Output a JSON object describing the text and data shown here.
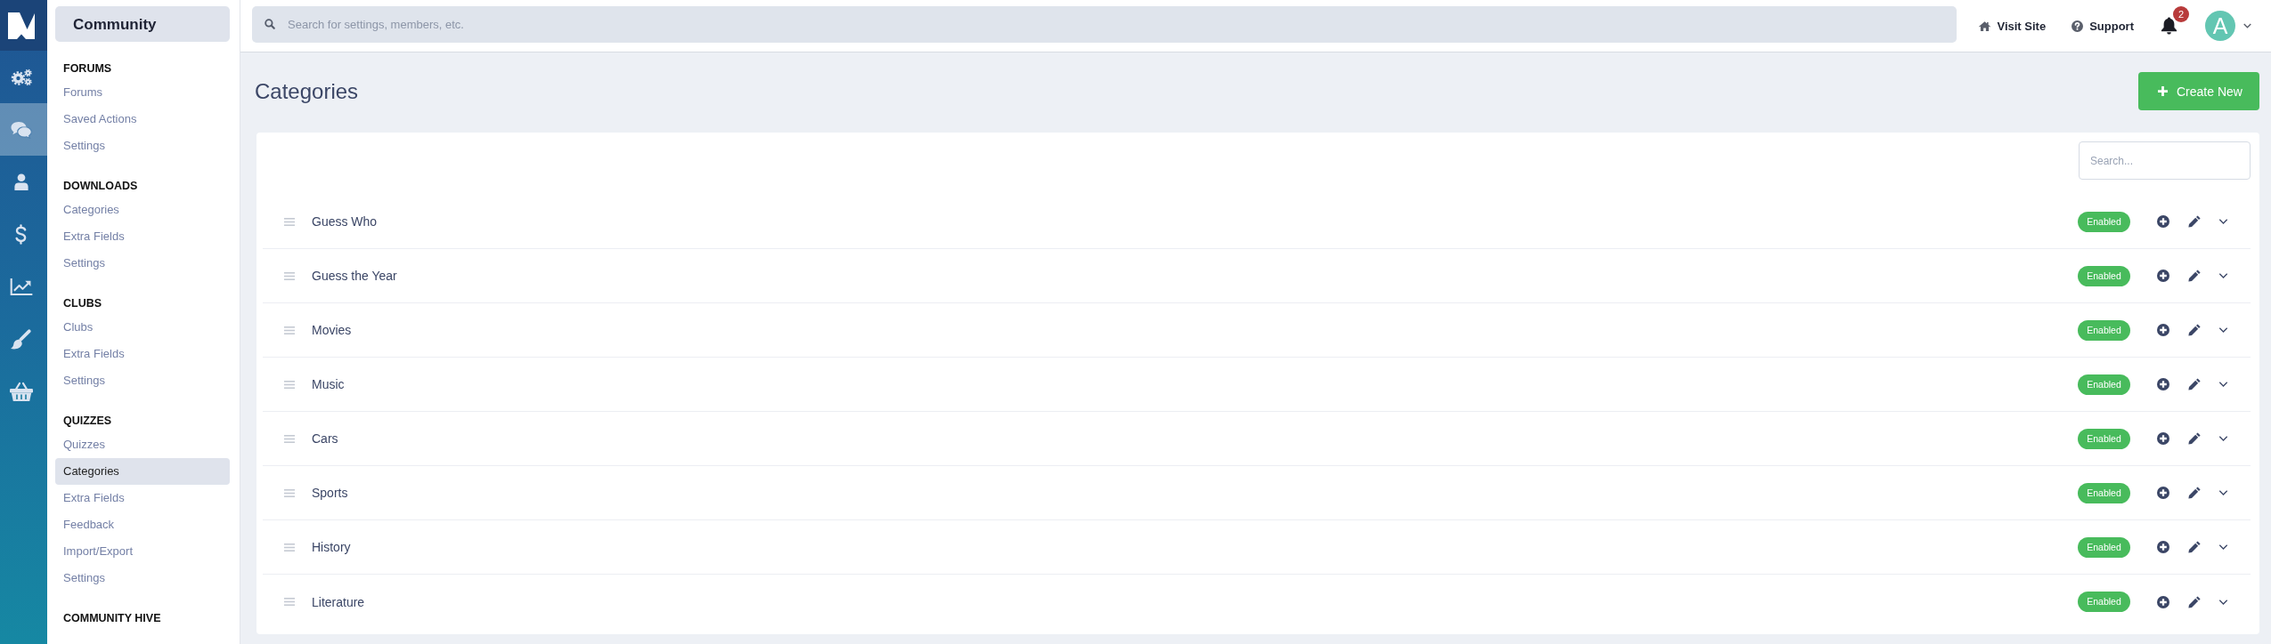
{
  "rail": {
    "items": [
      {
        "selected": false
      },
      {
        "selected": true
      },
      {
        "selected": false
      },
      {
        "selected": false
      },
      {
        "selected": false
      },
      {
        "selected": false
      },
      {
        "selected": false
      }
    ]
  },
  "sidebar": {
    "title": "Community",
    "sections": [
      {
        "heading": "FORUMS",
        "items": [
          {
            "label": "Forums",
            "selected": false
          },
          {
            "label": "Saved Actions",
            "selected": false
          },
          {
            "label": "Settings",
            "selected": false
          }
        ]
      },
      {
        "heading": "DOWNLOADS",
        "items": [
          {
            "label": "Categories",
            "selected": false
          },
          {
            "label": "Extra Fields",
            "selected": false
          },
          {
            "label": "Settings",
            "selected": false
          }
        ]
      },
      {
        "heading": "CLUBS",
        "items": [
          {
            "label": "Clubs",
            "selected": false
          },
          {
            "label": "Extra Fields",
            "selected": false
          },
          {
            "label": "Settings",
            "selected": false
          }
        ]
      },
      {
        "heading": "QUIZZES",
        "items": [
          {
            "label": "Quizzes",
            "selected": false
          },
          {
            "label": "Categories",
            "selected": true
          },
          {
            "label": "Extra Fields",
            "selected": false
          },
          {
            "label": "Feedback",
            "selected": false
          },
          {
            "label": "Import/Export",
            "selected": false
          },
          {
            "label": "Settings",
            "selected": false
          }
        ]
      },
      {
        "heading": "COMMUNITY HIVE"
      }
    ]
  },
  "topbar": {
    "search": {
      "placeholder": "Search for settings, members, etc."
    },
    "links": [
      {
        "label": "Visit Site"
      },
      {
        "label": "Support"
      }
    ],
    "notifications": {
      "count": "2"
    },
    "account": {
      "initial": "A"
    }
  },
  "page": {
    "title": "Categories",
    "create_button": {
      "label": "Create New"
    },
    "search": {
      "placeholder": "Search..."
    },
    "rows": [
      {
        "name": "Guess Who",
        "status": "Enabled"
      },
      {
        "name": "Guess the Year",
        "status": "Enabled"
      },
      {
        "name": "Movies",
        "status": "Enabled"
      },
      {
        "name": "Music",
        "status": "Enabled"
      },
      {
        "name": "Cars",
        "status": "Enabled"
      },
      {
        "name": "Sports",
        "status": "Enabled"
      },
      {
        "name": "History",
        "status": "Enabled"
      },
      {
        "name": "Literature",
        "status": "Enabled"
      }
    ]
  }
}
